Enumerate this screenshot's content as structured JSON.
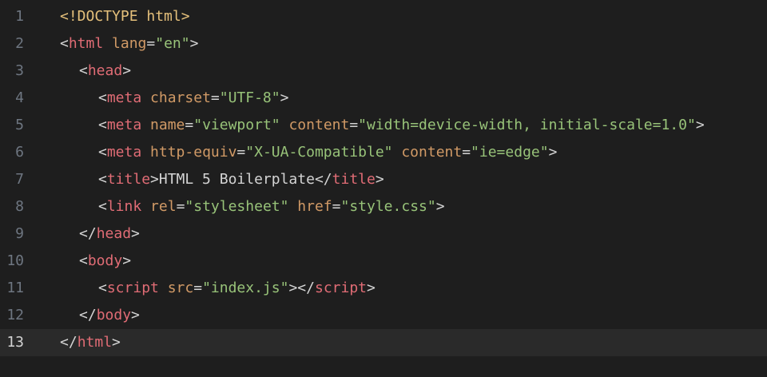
{
  "editor": {
    "active_line": 13,
    "lines": [
      {
        "num": "1",
        "indent": 0,
        "tokens": [
          {
            "t": "<!DOCTYPE html>",
            "c": "doctype"
          }
        ]
      },
      {
        "num": "2",
        "indent": 0,
        "tokens": [
          {
            "t": "<",
            "c": "punct"
          },
          {
            "t": "html",
            "c": "tag"
          },
          {
            "t": " ",
            "c": "text"
          },
          {
            "t": "lang",
            "c": "attr"
          },
          {
            "t": "=",
            "c": "punct"
          },
          {
            "t": "\"en\"",
            "c": "str"
          },
          {
            "t": ">",
            "c": "punct"
          }
        ]
      },
      {
        "num": "3",
        "indent": 1,
        "tokens": [
          {
            "t": "<",
            "c": "punct"
          },
          {
            "t": "head",
            "c": "tag"
          },
          {
            "t": ">",
            "c": "punct"
          }
        ]
      },
      {
        "num": "4",
        "indent": 2,
        "tokens": [
          {
            "t": "<",
            "c": "punct"
          },
          {
            "t": "meta",
            "c": "tag"
          },
          {
            "t": " ",
            "c": "text"
          },
          {
            "t": "charset",
            "c": "attr"
          },
          {
            "t": "=",
            "c": "punct"
          },
          {
            "t": "\"UTF-8\"",
            "c": "str"
          },
          {
            "t": ">",
            "c": "punct"
          }
        ]
      },
      {
        "num": "5",
        "indent": 2,
        "tokens": [
          {
            "t": "<",
            "c": "punct"
          },
          {
            "t": "meta",
            "c": "tag"
          },
          {
            "t": " ",
            "c": "text"
          },
          {
            "t": "name",
            "c": "attr"
          },
          {
            "t": "=",
            "c": "punct"
          },
          {
            "t": "\"viewport\"",
            "c": "str"
          },
          {
            "t": " ",
            "c": "text"
          },
          {
            "t": "content",
            "c": "attr"
          },
          {
            "t": "=",
            "c": "punct"
          },
          {
            "t": "\"width=device-width, initial-scale=1.0\"",
            "c": "str"
          },
          {
            "t": ">",
            "c": "punct"
          }
        ]
      },
      {
        "num": "6",
        "indent": 2,
        "tokens": [
          {
            "t": "<",
            "c": "punct"
          },
          {
            "t": "meta",
            "c": "tag"
          },
          {
            "t": " ",
            "c": "text"
          },
          {
            "t": "http-equiv",
            "c": "attr"
          },
          {
            "t": "=",
            "c": "punct"
          },
          {
            "t": "\"X-UA-Compatible\"",
            "c": "str"
          },
          {
            "t": " ",
            "c": "text"
          },
          {
            "t": "content",
            "c": "attr"
          },
          {
            "t": "=",
            "c": "punct"
          },
          {
            "t": "\"ie=edge\"",
            "c": "str"
          },
          {
            "t": ">",
            "c": "punct"
          }
        ]
      },
      {
        "num": "7",
        "indent": 2,
        "tokens": [
          {
            "t": "<",
            "c": "punct"
          },
          {
            "t": "title",
            "c": "tag"
          },
          {
            "t": ">",
            "c": "punct"
          },
          {
            "t": "HTML 5 Boilerplate",
            "c": "text"
          },
          {
            "t": "</",
            "c": "punct"
          },
          {
            "t": "title",
            "c": "tag"
          },
          {
            "t": ">",
            "c": "punct"
          }
        ]
      },
      {
        "num": "8",
        "indent": 2,
        "tokens": [
          {
            "t": "<",
            "c": "punct"
          },
          {
            "t": "link",
            "c": "tag"
          },
          {
            "t": " ",
            "c": "text"
          },
          {
            "t": "rel",
            "c": "attr"
          },
          {
            "t": "=",
            "c": "punct"
          },
          {
            "t": "\"stylesheet\"",
            "c": "str"
          },
          {
            "t": " ",
            "c": "text"
          },
          {
            "t": "href",
            "c": "attr"
          },
          {
            "t": "=",
            "c": "punct"
          },
          {
            "t": "\"style.css\"",
            "c": "str"
          },
          {
            "t": ">",
            "c": "punct"
          }
        ]
      },
      {
        "num": "9",
        "indent": 1,
        "tokens": [
          {
            "t": "</",
            "c": "punct"
          },
          {
            "t": "head",
            "c": "tag"
          },
          {
            "t": ">",
            "c": "punct"
          }
        ]
      },
      {
        "num": "10",
        "indent": 1,
        "tokens": [
          {
            "t": "<",
            "c": "punct"
          },
          {
            "t": "body",
            "c": "tag"
          },
          {
            "t": ">",
            "c": "punct"
          }
        ]
      },
      {
        "num": "11",
        "indent": 2,
        "tokens": [
          {
            "t": "<",
            "c": "punct"
          },
          {
            "t": "script",
            "c": "tag"
          },
          {
            "t": " ",
            "c": "text"
          },
          {
            "t": "src",
            "c": "attr"
          },
          {
            "t": "=",
            "c": "punct"
          },
          {
            "t": "\"index.js\"",
            "c": "str"
          },
          {
            "t": ">",
            "c": "punct"
          },
          {
            "t": "</",
            "c": "punct"
          },
          {
            "t": "script",
            "c": "tag"
          },
          {
            "t": ">",
            "c": "punct"
          }
        ]
      },
      {
        "num": "12",
        "indent": 1,
        "tokens": [
          {
            "t": "</",
            "c": "punct"
          },
          {
            "t": "body",
            "c": "tag"
          },
          {
            "t": ">",
            "c": "punct"
          }
        ]
      },
      {
        "num": "13",
        "indent": 0,
        "tokens": [
          {
            "t": "</",
            "c": "punct"
          },
          {
            "t": "html",
            "c": "tag"
          },
          {
            "t": ">",
            "c": "punct"
          }
        ]
      }
    ]
  },
  "colors": {
    "background": "#1e1e1e",
    "active_line": "#2a2a2a",
    "line_number": "#6e7681",
    "tag": "#e06c75",
    "attribute": "#d19a66",
    "string": "#98c379",
    "doctype": "#e5c07b",
    "text": "#d4d4d4"
  }
}
